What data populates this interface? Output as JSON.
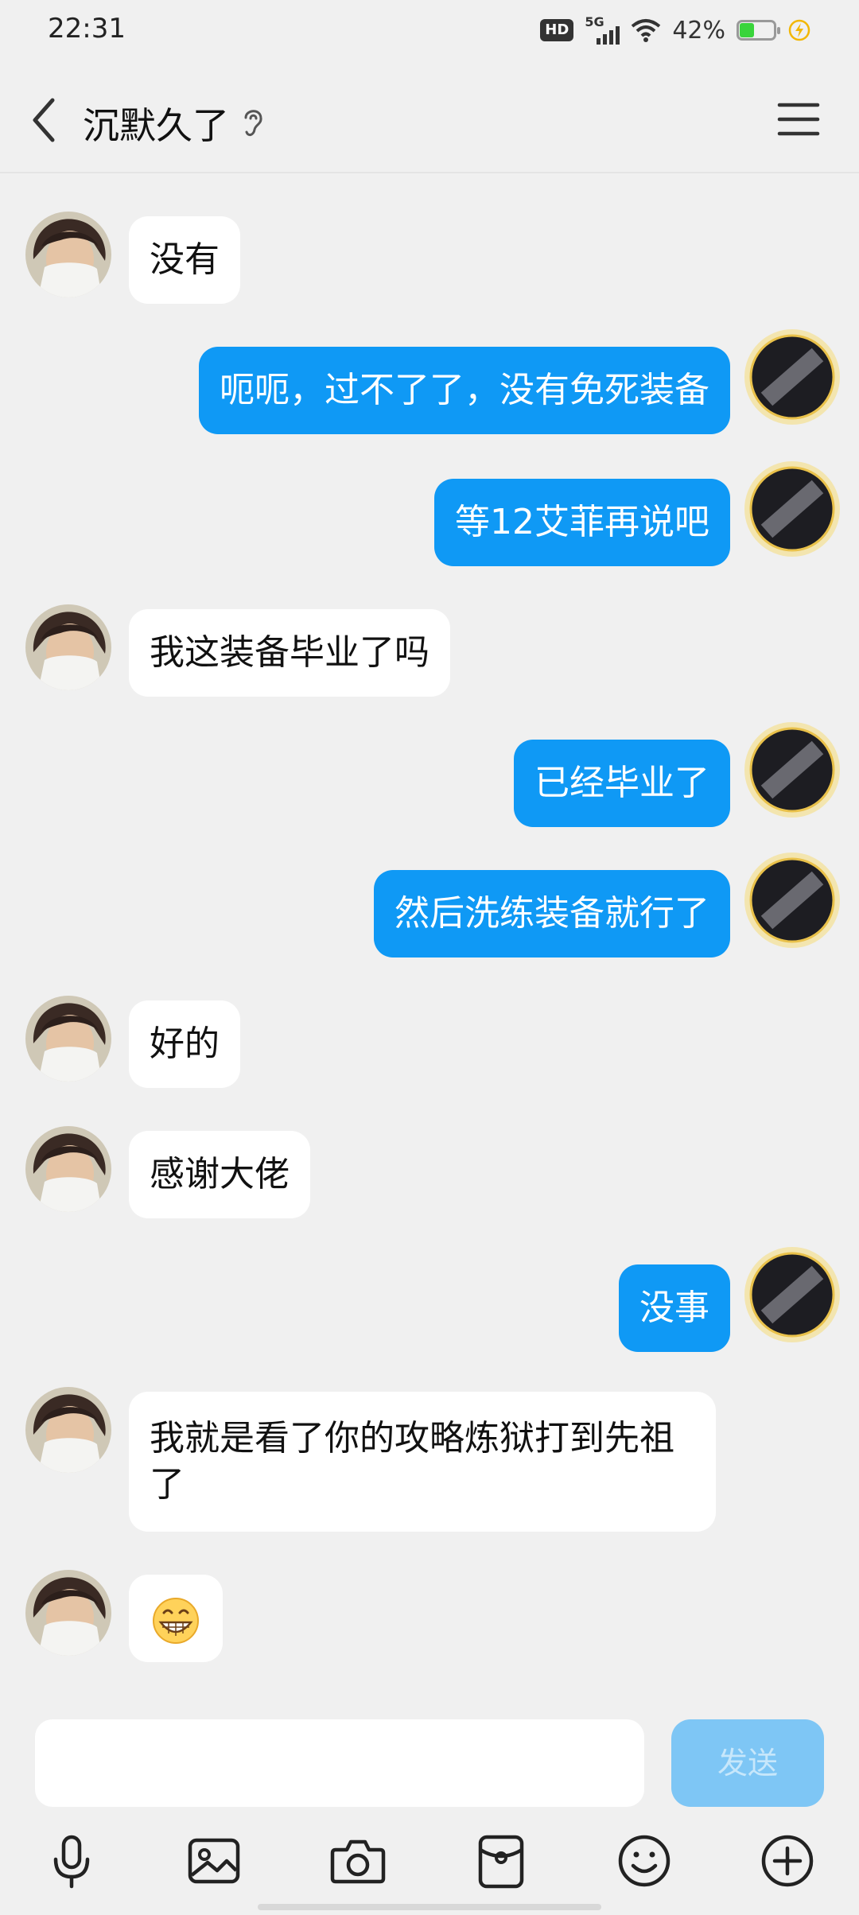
{
  "status": {
    "time": "22:31",
    "hd": "HD",
    "network": "5G",
    "battery_pct": "42%",
    "battery_level": 0.42,
    "accent_green": "#39d43b"
  },
  "header": {
    "title": "沉默久了",
    "back_icon": "chevron-left-icon",
    "ear_icon": "ear-icon",
    "menu_icon": "hamburger-menu-icon"
  },
  "messages": [
    {
      "side": "left",
      "text": "没有"
    },
    {
      "side": "right",
      "text": "呃呃，过不了了，没有免死装备"
    },
    {
      "side": "right",
      "text": "等12艾菲再说吧"
    },
    {
      "side": "left",
      "text": "我这装备毕业了吗"
    },
    {
      "side": "right",
      "text": "已经毕业了"
    },
    {
      "side": "right",
      "text": "然后洗练装备就行了"
    },
    {
      "side": "left",
      "text": "好的"
    },
    {
      "side": "left",
      "text": "感谢大佬"
    },
    {
      "side": "right",
      "text": "没事"
    },
    {
      "side": "left",
      "text": "我就是看了你的攻略炼狱打到先祖了"
    },
    {
      "side": "left",
      "text": "😁"
    }
  ],
  "input": {
    "placeholder": "",
    "value": "",
    "send_label": "发送"
  },
  "toolbar": [
    {
      "icon": "microphone-icon"
    },
    {
      "icon": "image-icon"
    },
    {
      "icon": "camera-icon"
    },
    {
      "icon": "red-packet-icon"
    },
    {
      "icon": "emoji-icon"
    },
    {
      "icon": "plus-icon"
    }
  ],
  "colors": {
    "background": "#f0f0f0",
    "bubble_left": "#ffffff",
    "bubble_right": "#0f99f5",
    "send_disabled": "#7ec6f5"
  }
}
